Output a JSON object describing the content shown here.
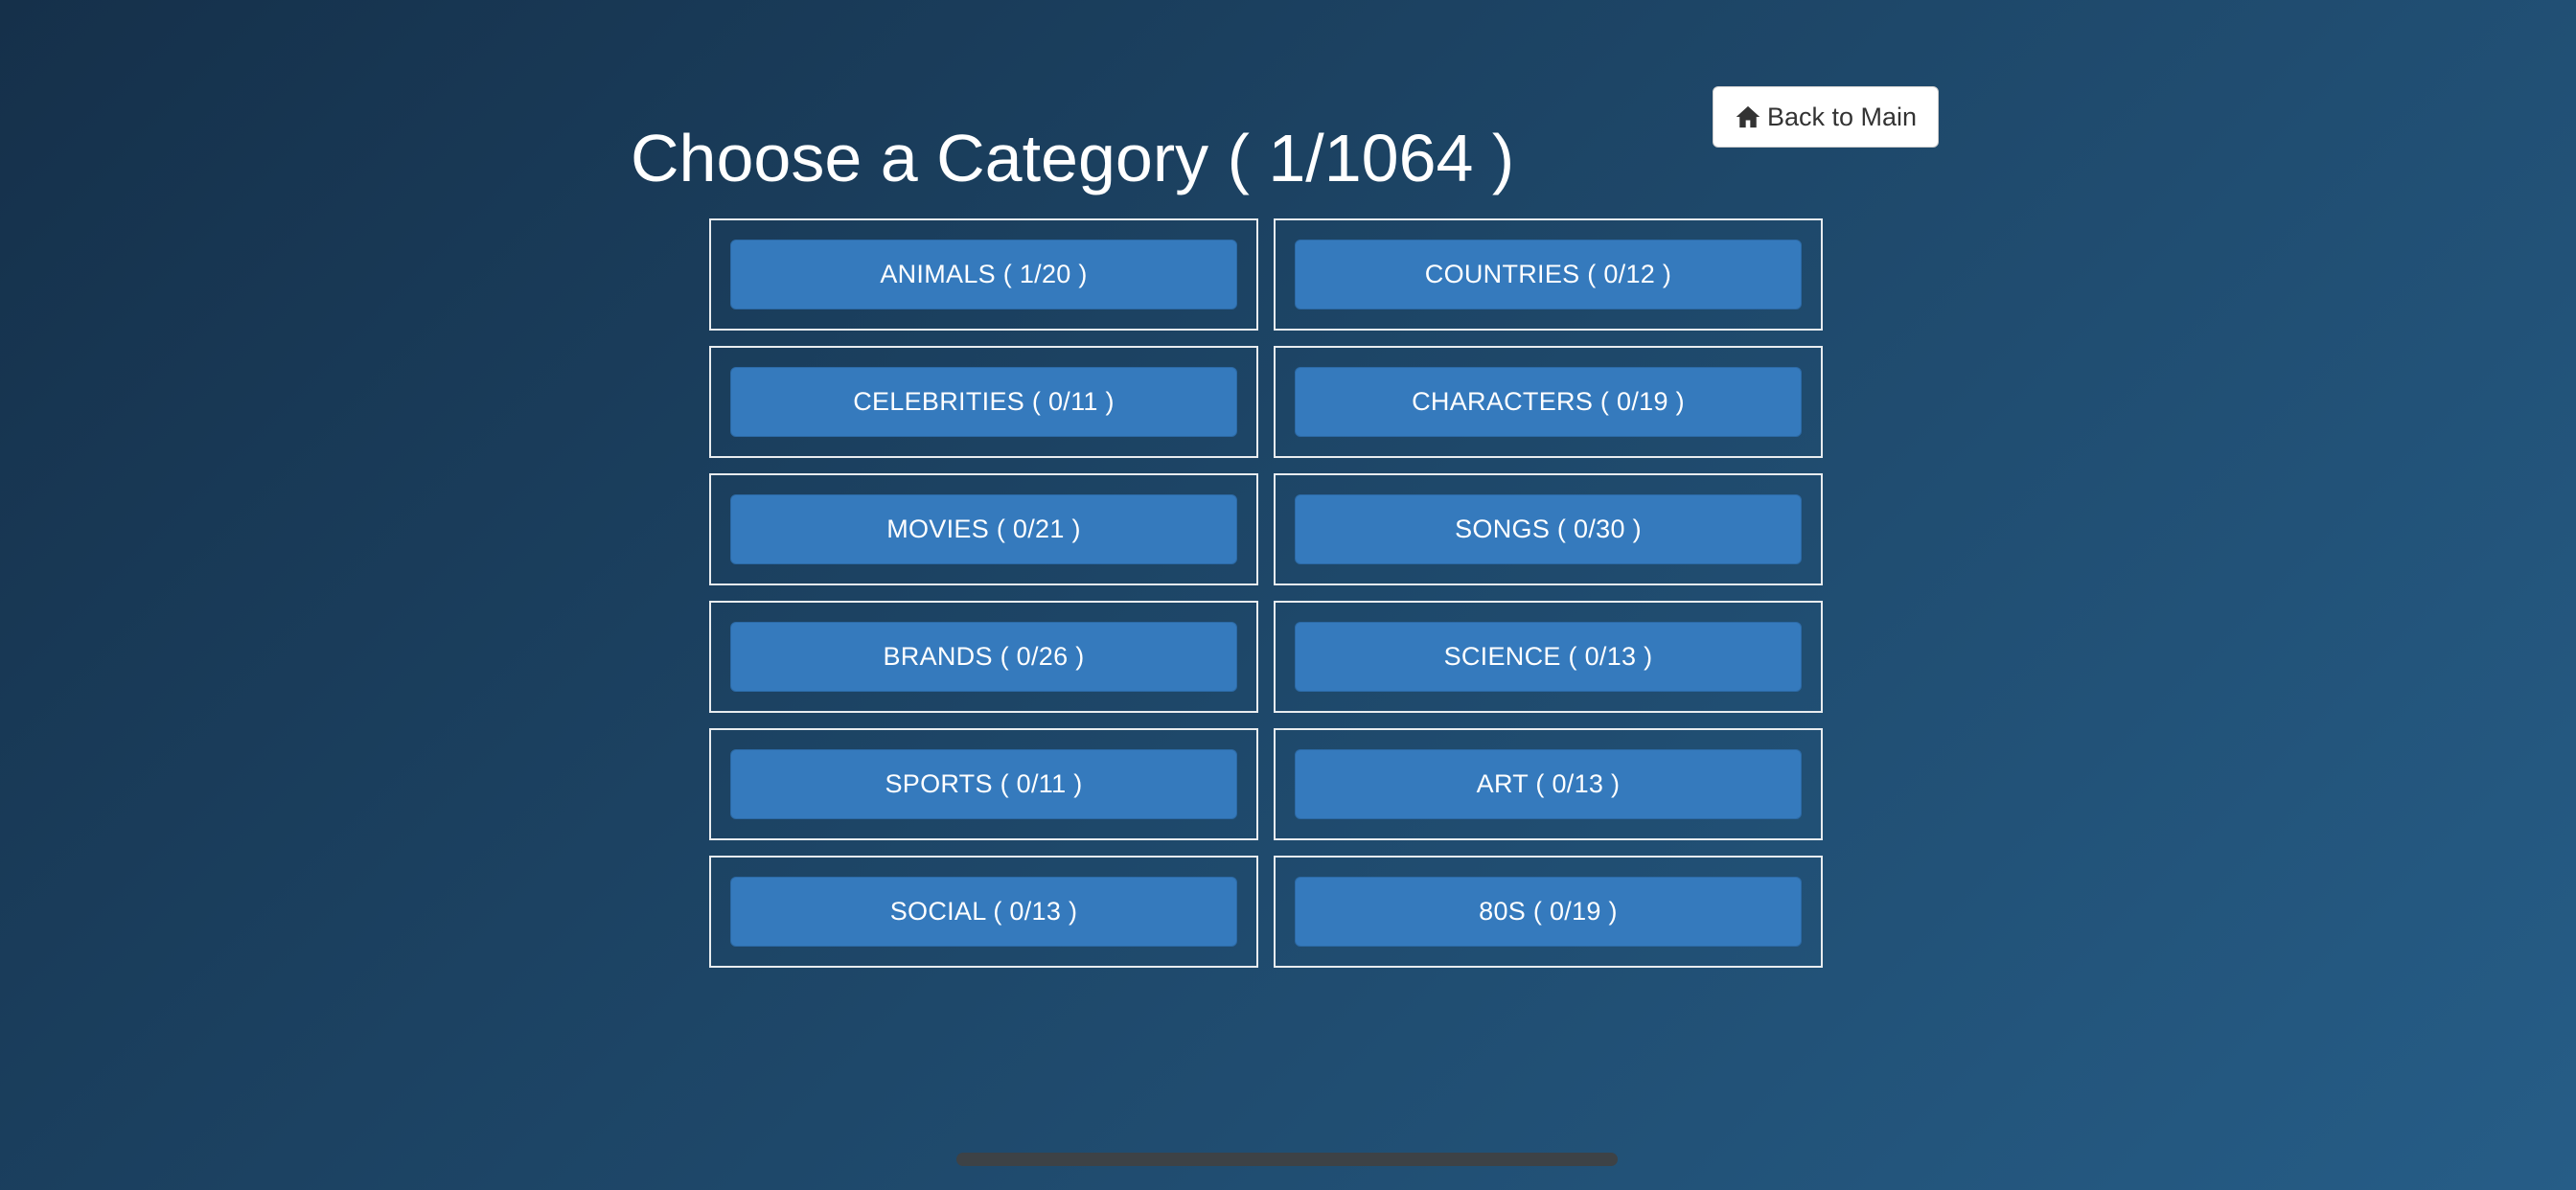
{
  "header": {
    "title": "Choose a Category ( 1/1064 )",
    "back_label": "Back to Main",
    "back_icon": "home-icon"
  },
  "categories": [
    {
      "label": "ANIMALS ( 1/20 )"
    },
    {
      "label": "COUNTRIES ( 0/12 )"
    },
    {
      "label": "CELEBRITIES ( 0/11 )"
    },
    {
      "label": "CHARACTERS ( 0/19 )"
    },
    {
      "label": "MOVIES ( 0/21 )"
    },
    {
      "label": "SONGS ( 0/30 )"
    },
    {
      "label": "BRANDS ( 0/26 )"
    },
    {
      "label": "SCIENCE ( 0/13 )"
    },
    {
      "label": "SPORTS ( 0/11 )"
    },
    {
      "label": "ART ( 0/13 )"
    },
    {
      "label": "SOCIAL ( 0/13 )"
    },
    {
      "label": "80S ( 0/19 )"
    }
  ],
  "colors": {
    "background_start": "#15304a",
    "background_end": "#265d87",
    "button_blue": "#357abd",
    "cell_border": "#e8ecef",
    "back_button_bg": "#ffffff"
  }
}
